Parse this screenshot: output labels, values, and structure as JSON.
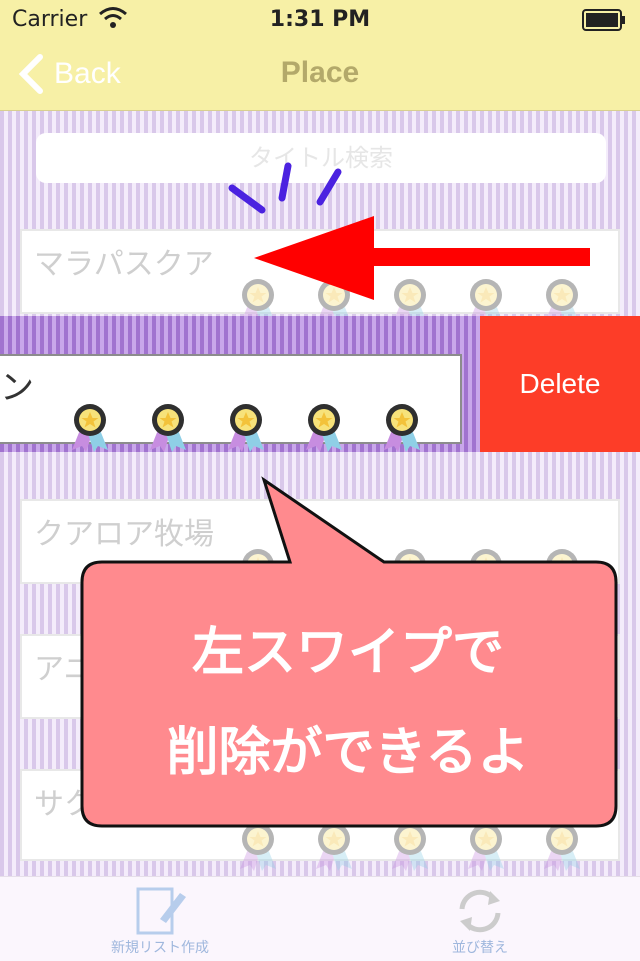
{
  "status_bar": {
    "carrier": "Carrier",
    "time": "1:31 PM"
  },
  "nav": {
    "back_label": "Back",
    "title": "Place"
  },
  "search": {
    "placeholder": "タイトル検索"
  },
  "rows": [
    {
      "name": "マラパスクア"
    },
    {
      "name": "クアロア牧場"
    },
    {
      "name": "アニ"
    },
    {
      "name": "サク"
    }
  ],
  "swiped_row": {
    "name": "ン",
    "delete_label": "Delete"
  },
  "overlay": {
    "line1": "左スワイプで",
    "line2": "削除ができるよ"
  },
  "tabbar": {
    "new_list": "新規リスト作成",
    "sort": "並び替え"
  },
  "colors": {
    "nav_bg": "#f7f0a6",
    "delete": "#fd3d28",
    "bubble": "#ff8a8e",
    "arrow": "#ff0000",
    "accent_stripe": "#a173cf"
  }
}
